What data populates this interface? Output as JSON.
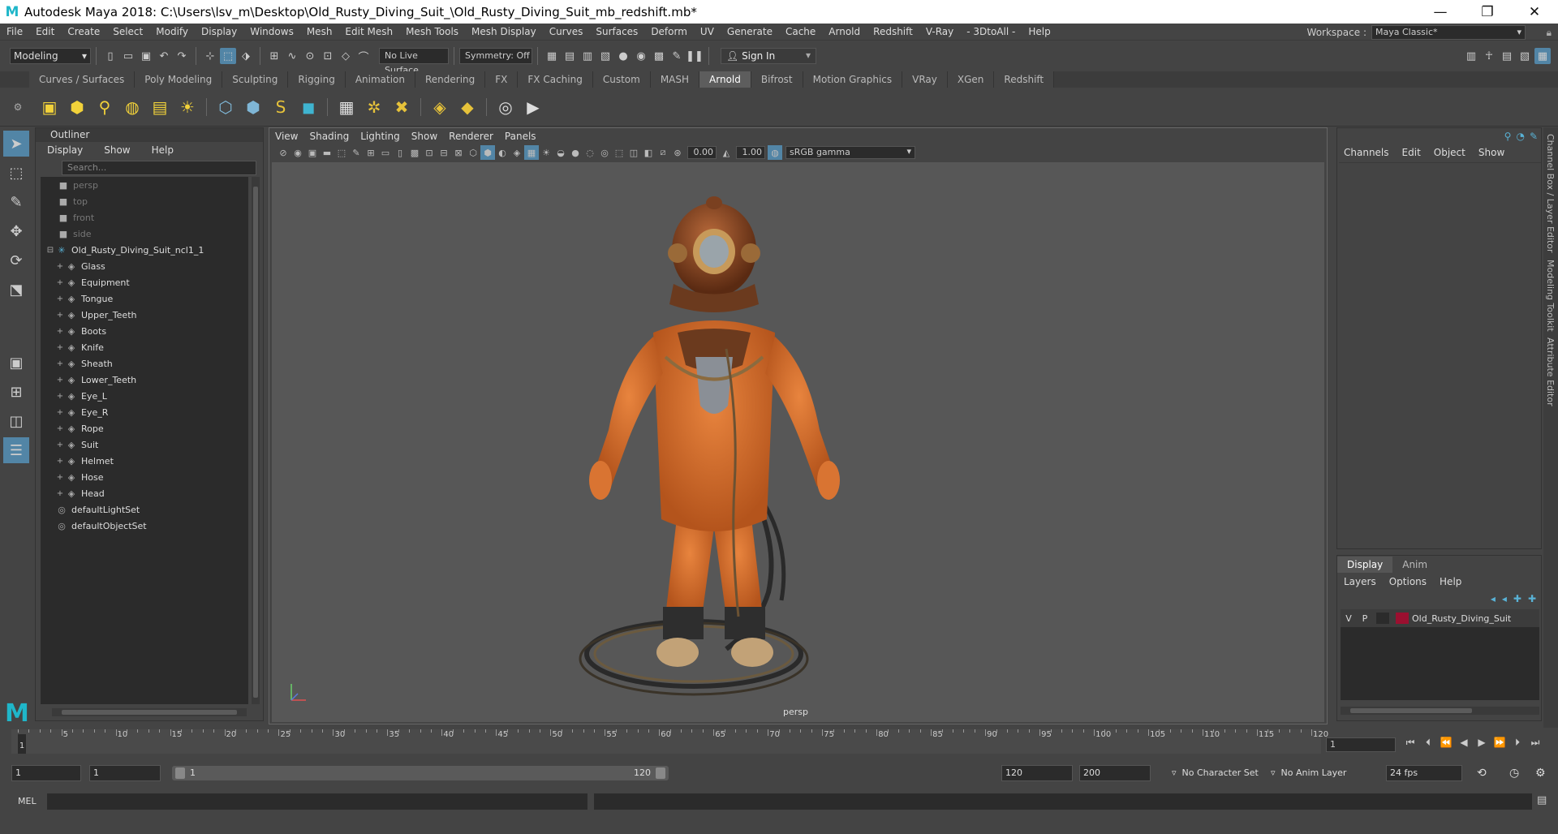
{
  "window": {
    "title": "Autodesk Maya 2018: C:\\Users\\lsv_m\\Desktop\\Old_Rusty_Diving_Suit_\\Old_Rusty_Diving_Suit_mb_redshift.mb*",
    "minimize": "—",
    "maximize": "❐",
    "close": "✕"
  },
  "menubar": {
    "items": [
      "File",
      "Edit",
      "Create",
      "Select",
      "Modify",
      "Display",
      "Windows",
      "Mesh",
      "Edit Mesh",
      "Mesh Tools",
      "Mesh Display",
      "Curves",
      "Surfaces",
      "Deform",
      "UV",
      "Generate",
      "Cache",
      "Arnold",
      "Redshift",
      "V-Ray",
      "- 3DtoAll -",
      "Help"
    ],
    "workspace_label": "Workspace :",
    "workspace_value": "Maya Classic*"
  },
  "statusline": {
    "mode": "Modeling",
    "live_surface": "No Live Surface",
    "symmetry": "Symmetry: Off",
    "sign_in": "Sign In"
  },
  "shelf": {
    "tabs": [
      "Curves / Surfaces",
      "Poly Modeling",
      "Sculpting",
      "Rigging",
      "Animation",
      "Rendering",
      "FX",
      "FX Caching",
      "Custom",
      "MASH",
      "Arnold",
      "Bifrost",
      "Motion Graphics",
      "VRay",
      "XGen",
      "Redshift"
    ],
    "active_tab": "Arnold"
  },
  "outliner": {
    "title": "Outliner",
    "menu": [
      "Display",
      "Show",
      "Help"
    ],
    "search_placeholder": "Search...",
    "cameras": [
      "persp",
      "top",
      "front",
      "side"
    ],
    "group": "Old_Rusty_Diving_Suit_ncl1_1",
    "children": [
      "Glass",
      "Equipment",
      "Tongue",
      "Upper_Teeth",
      "Boots",
      "Knife",
      "Sheath",
      "Lower_Teeth",
      "Eye_L",
      "Eye_R",
      "Rope",
      "Suit",
      "Helmet",
      "Hose",
      "Head"
    ],
    "sets": [
      "defaultLightSet",
      "defaultObjectSet"
    ]
  },
  "viewport": {
    "menu": [
      "View",
      "Shading",
      "Lighting",
      "Show",
      "Renderer",
      "Panels"
    ],
    "near_value": "0.00",
    "far_value": "1.00",
    "color_space": "sRGB gamma",
    "camera_label": "persp"
  },
  "channelbox": {
    "menu": [
      "Channels",
      "Edit",
      "Object",
      "Show"
    ],
    "side_tabs": [
      "Channel Box / Layer Editor",
      "Modeling Toolkit",
      "Attribute Editor"
    ]
  },
  "layer_editor": {
    "tabs": [
      "Display",
      "Anim"
    ],
    "active_tab": "Display",
    "menu": [
      "Layers",
      "Options",
      "Help"
    ],
    "layers": [
      {
        "v": "V",
        "p": "P",
        "name": "Old_Rusty_Diving_Suit",
        "color": "#9b1030"
      }
    ]
  },
  "timeline": {
    "ticks": [
      "5",
      "10",
      "15",
      "20",
      "25",
      "30",
      "35",
      "40",
      "45",
      "50",
      "55",
      "60",
      "65",
      "70",
      "75",
      "80",
      "85",
      "90",
      "95",
      "100",
      "105",
      "110",
      "115",
      "120"
    ],
    "current_frame": "1",
    "current_frame_field": "1"
  },
  "range": {
    "start": "1",
    "playback_start": "1",
    "range_start": "1",
    "range_end": "120",
    "playback_end": "120",
    "end": "200",
    "character_set": "No Character Set",
    "anim_layer": "No Anim Layer",
    "fps": "24 fps"
  },
  "cmdline": {
    "label": "MEL"
  }
}
